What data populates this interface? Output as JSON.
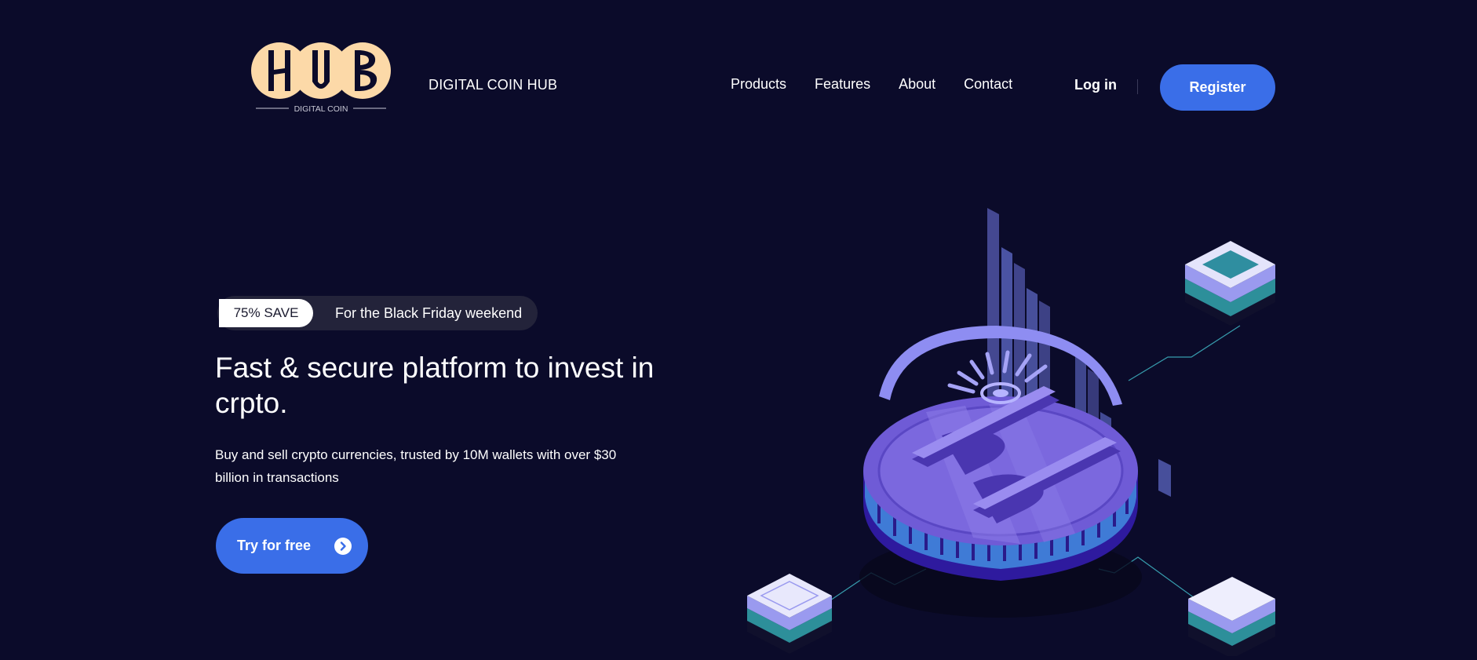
{
  "header": {
    "logo_text": "HUB",
    "logo_subtext": "DIGITAL COIN",
    "brand_name": "DIGITAL COIN HUB",
    "nav": [
      "Products",
      "Features",
      "About",
      "Contact"
    ],
    "login_label": "Log in",
    "register_label": "Register"
  },
  "hero": {
    "promo_badge": "75% SAVE",
    "promo_text": "For the Black Friday weekend",
    "title": "Fast & secure platform to invest in crpto.",
    "subtitle": "Buy and sell crypto currencies, trusted by 10M wallets with over $30 billion in transactions",
    "cta_label": "Try for free",
    "cta_icon": "chevron-right-circle-icon"
  },
  "illustration": {
    "icon": "crypto-coin-isometric-illustration"
  },
  "colors": {
    "background": "#0b0b2a",
    "accent": "#3a6ee8",
    "logo": "#fcd9a8",
    "promo_pill": "#23233a",
    "coin_purple": "#6f5bd6",
    "teal": "#3fb6c4"
  }
}
